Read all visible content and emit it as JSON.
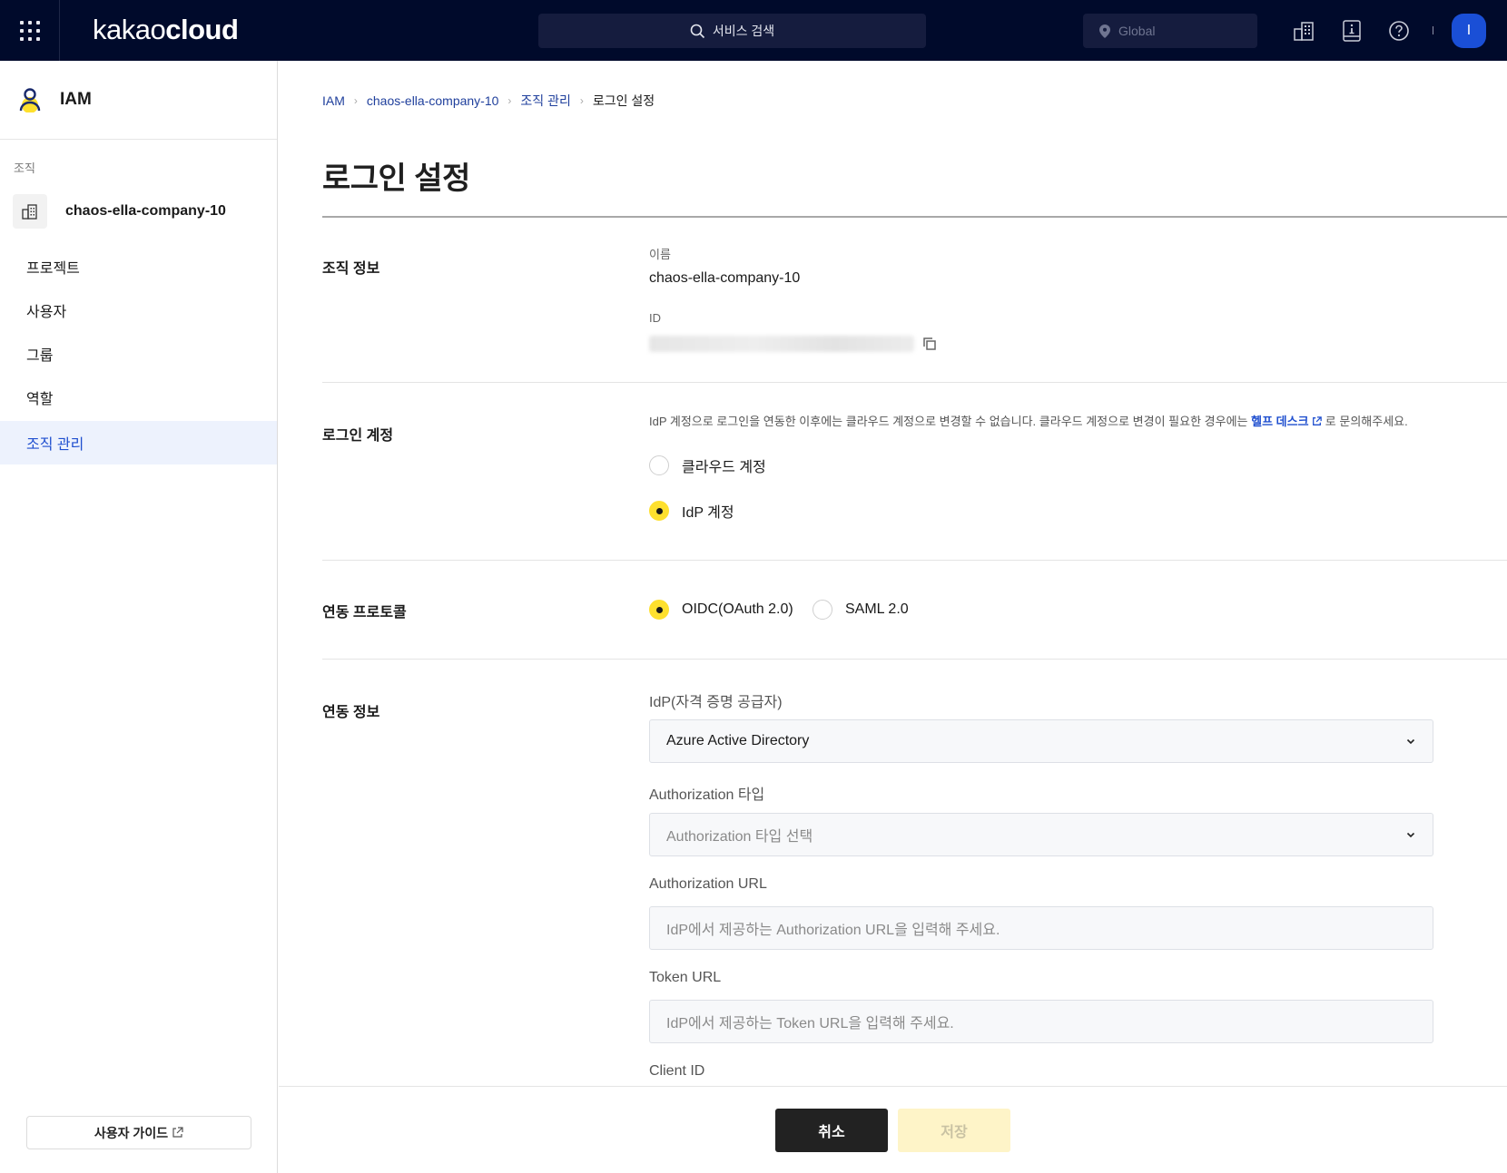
{
  "header": {
    "brand_light": "kakao",
    "brand_bold": "cloud",
    "search_placeholder": "서비스 검색",
    "region": "Global",
    "avatar_initial": "I"
  },
  "sidebar": {
    "service_title": "IAM",
    "section_label": "조직",
    "org_name": "chaos-ella-company-10",
    "items": [
      {
        "label": "프로젝트",
        "active": false
      },
      {
        "label": "사용자",
        "active": false
      },
      {
        "label": "그룹",
        "active": false
      },
      {
        "label": "역할",
        "active": false
      },
      {
        "label": "조직 관리",
        "active": true
      }
    ],
    "guide_button": "사용자 가이드"
  },
  "breadcrumb": [
    "IAM",
    "chaos-ella-company-10",
    "조직 관리",
    "로그인 설정"
  ],
  "page_title": "로그인 설정",
  "sections": {
    "org_info": {
      "label": "조직 정보",
      "name_label": "이름",
      "name_value": "chaos-ella-company-10",
      "id_label": "ID",
      "id_value_redacted": true
    },
    "login_account": {
      "label": "로그인 계정",
      "notice_prefix": "IdP 계정으로 로그인을 연동한 이후에는 클라우드 계정으로 변경할 수 없습니다. 클라우드 계정으로 변경이 필요한 경우에는",
      "notice_link": "헬프 데스크",
      "notice_suffix": "로 문의해주세요.",
      "options": [
        {
          "label": "클라우드 계정",
          "checked": false
        },
        {
          "label": "IdP 계정",
          "checked": true
        }
      ]
    },
    "protocol": {
      "label": "연동 프로토콜",
      "options": [
        {
          "label": "OIDC(OAuth 2.0)",
          "checked": true
        },
        {
          "label": "SAML 2.0",
          "checked": false
        }
      ]
    },
    "federation": {
      "label": "연동 정보",
      "idp_label": "IdP(자격 증명 공급자)",
      "idp_value": "Azure Active Directory",
      "auth_type_label": "Authorization 타입",
      "auth_type_placeholder": "Authorization 타입 선택",
      "auth_url_label": "Authorization URL",
      "auth_url_placeholder": "IdP에서 제공하는 Authorization URL을 입력해 주세요.",
      "token_url_label": "Token URL",
      "token_url_placeholder": "IdP에서 제공하는 Token URL을 입력해 주세요.",
      "client_id_label": "Client ID"
    }
  },
  "footer": {
    "cancel": "취소",
    "save": "저장",
    "save_enabled": false
  },
  "colors": {
    "header_bg": "#000a2b",
    "accent_blue": "#1f4fcf",
    "radio_checked": "#fee02e",
    "avatar_bg": "#1a4fd6"
  }
}
